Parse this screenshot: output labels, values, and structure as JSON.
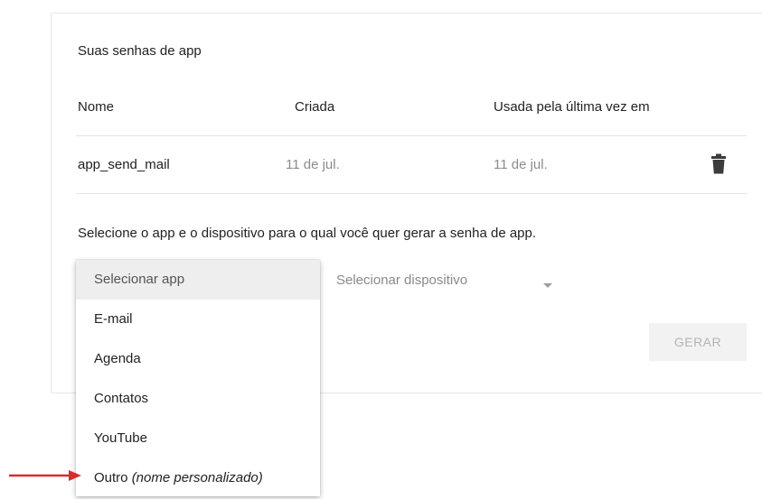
{
  "card": {
    "title": "Suas senhas de app"
  },
  "table": {
    "columns": [
      "Nome",
      "Criada",
      "Usada pela última vez em"
    ],
    "rows": [
      {
        "name": "app_send_mail",
        "created": "11 de jul.",
        "last_used": "11 de jul.",
        "action_icon": "trash-icon"
      }
    ]
  },
  "generate": {
    "instruction": "Selecione o app e o dispositivo para o qual você quer gerar a senha de app.",
    "device_select_label": "Selecionar dispositivo",
    "button_label": "GERAR"
  },
  "app_dropdown": {
    "items": [
      {
        "label": "Selecionar app",
        "selected": true
      },
      {
        "label": "E-mail"
      },
      {
        "label": "Agenda"
      },
      {
        "label": "Contatos"
      },
      {
        "label": "YouTube"
      },
      {
        "label": "Outro",
        "note": "(nome personalizado)"
      }
    ]
  },
  "colors": {
    "annotation_arrow": "#d32f2f",
    "disabled_text": "#b4b4b4"
  }
}
